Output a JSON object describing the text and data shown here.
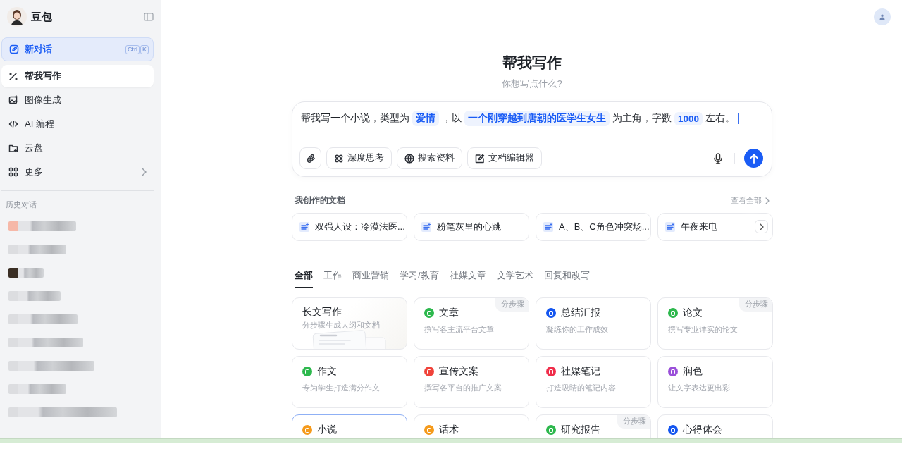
{
  "sidebar": {
    "app_name": "豆包",
    "new_chat": {
      "label": "新对话",
      "shortcut": [
        "Ctrl",
        "K"
      ]
    },
    "items": [
      {
        "label": "帮我写作",
        "selected": true,
        "kind": "write"
      },
      {
        "label": "图像生成",
        "selected": false,
        "kind": "image"
      },
      {
        "label": "AI 编程",
        "selected": false,
        "kind": "code"
      },
      {
        "label": "云盘",
        "selected": false,
        "kind": "drive"
      },
      {
        "label": "更多",
        "selected": false,
        "kind": "more"
      }
    ],
    "history": {
      "title": "历史对话",
      "items": [
        {
          "kind": "redacted"
        },
        {
          "kind": "redacted"
        },
        {
          "kind": "redacted"
        },
        {
          "kind": "redacted"
        },
        {
          "kind": "redacted"
        },
        {
          "kind": "redacted"
        },
        {
          "kind": "redacted"
        },
        {
          "kind": "redacted"
        },
        {
          "kind": "redacted"
        }
      ]
    }
  },
  "main": {
    "title": "帮我写作",
    "subtitle": "你想写点什么?",
    "prompt": [
      {
        "kind": "text",
        "text": "帮我写一个小说，类型为"
      },
      {
        "kind": "slot",
        "text": "爱情"
      },
      {
        "kind": "text",
        "text": "，以"
      },
      {
        "kind": "slot",
        "text": "一个刚穿越到唐朝的医学生女生"
      },
      {
        "kind": "text",
        "text": "为主角，字数"
      },
      {
        "kind": "slot",
        "text": "1000"
      },
      {
        "kind": "text",
        "text": "左右。"
      }
    ],
    "tools": [
      {
        "kind": "attach"
      },
      {
        "kind": "think",
        "label": "深度思考"
      },
      {
        "kind": "search",
        "label": "搜索资料"
      },
      {
        "kind": "editor",
        "label": "文档编辑器"
      }
    ],
    "documents": {
      "title": "我创作的文档",
      "view_all": "查看全部",
      "items": [
        "双强人设：冷漠法医...",
        "粉笔灰里的心跳",
        "A、B、C角色冲突场...",
        "午夜来电"
      ]
    },
    "tabs": [
      {
        "label": "全部",
        "selected": true
      },
      {
        "label": "工作",
        "selected": false
      },
      {
        "label": "商业营销",
        "selected": false
      },
      {
        "label": "学习/教育",
        "selected": false
      },
      {
        "label": "社媒文章",
        "selected": false
      },
      {
        "label": "文学艺术",
        "selected": false
      },
      {
        "label": "回复和改写",
        "selected": false
      }
    ],
    "cards": [
      {
        "kind": "feature",
        "title": "长文写作",
        "desc": "分步骤生成大纲和文档",
        "selected": false
      },
      {
        "kind": "tool",
        "title": "文章",
        "desc": "撰写各主流平台文章",
        "badge": "分步骤",
        "color": "#2db84d",
        "selected": false
      },
      {
        "kind": "tool",
        "title": "总结汇报",
        "desc": "凝练你的工作成效",
        "color": "#1456f0",
        "selected": false
      },
      {
        "kind": "tool",
        "title": "论文",
        "desc": "撰写专业详实的论文",
        "badge": "分步骤",
        "color": "#2db84d",
        "selected": false
      },
      {
        "kind": "tool",
        "title": "作文",
        "desc": "专为学生打造满分作文",
        "color": "#2db84d",
        "selected": false
      },
      {
        "kind": "tool",
        "title": "宣传文案",
        "desc": "撰写各平台的推广文案",
        "color": "#f0433a",
        "selected": false
      },
      {
        "kind": "tool",
        "title": "社媒笔记",
        "desc": "打造吸睛的笔记内容",
        "color": "#f02d4a",
        "selected": false
      },
      {
        "kind": "tool",
        "title": "润色",
        "desc": "让文字表达更出彩",
        "color": "#9a4fd9",
        "selected": false
      },
      {
        "kind": "tool",
        "title": "小说",
        "color": "#f59a1b",
        "selected": true
      },
      {
        "kind": "tool",
        "title": "话术",
        "color": "#f59a1b",
        "selected": false
      },
      {
        "kind": "tool",
        "title": "研究报告",
        "badge": "分步骤",
        "color": "#2db84d",
        "selected": false
      },
      {
        "kind": "tool",
        "title": "心得体会",
        "color": "#1456f0",
        "selected": false
      }
    ]
  }
}
